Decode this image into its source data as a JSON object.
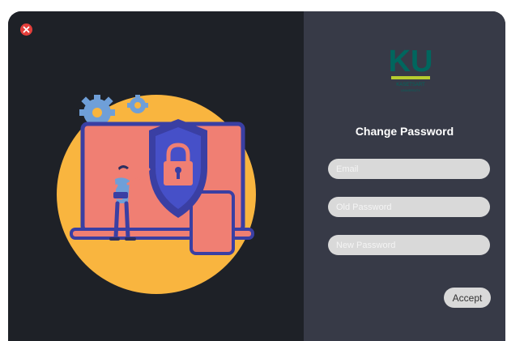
{
  "window": {
    "close_icon": "close-icon",
    "close_color": "#e43f3b"
  },
  "illustration": {
    "subject": "security-shield-lock-icon",
    "circle_color": "#f9b53f",
    "shield_color": "#3a3fa3",
    "screen_color": "#f07f73",
    "gear_color": "#6f9fd8"
  },
  "logo": {
    "letters": "KU",
    "subtitle": "KASETSART",
    "subtitle2": "UNIVERSITY",
    "brand_color": "#00665e",
    "accent_color": "#b6cc2e"
  },
  "form": {
    "title": "Change Password",
    "email_placeholder": "Email",
    "old_password_placeholder": "Old Password",
    "new_password_placeholder": "New Password",
    "accept_label": "Accept"
  },
  "colors": {
    "left_bg": "#1e2127",
    "right_bg": "#373a47",
    "field_bg": "#d9d9d9"
  }
}
